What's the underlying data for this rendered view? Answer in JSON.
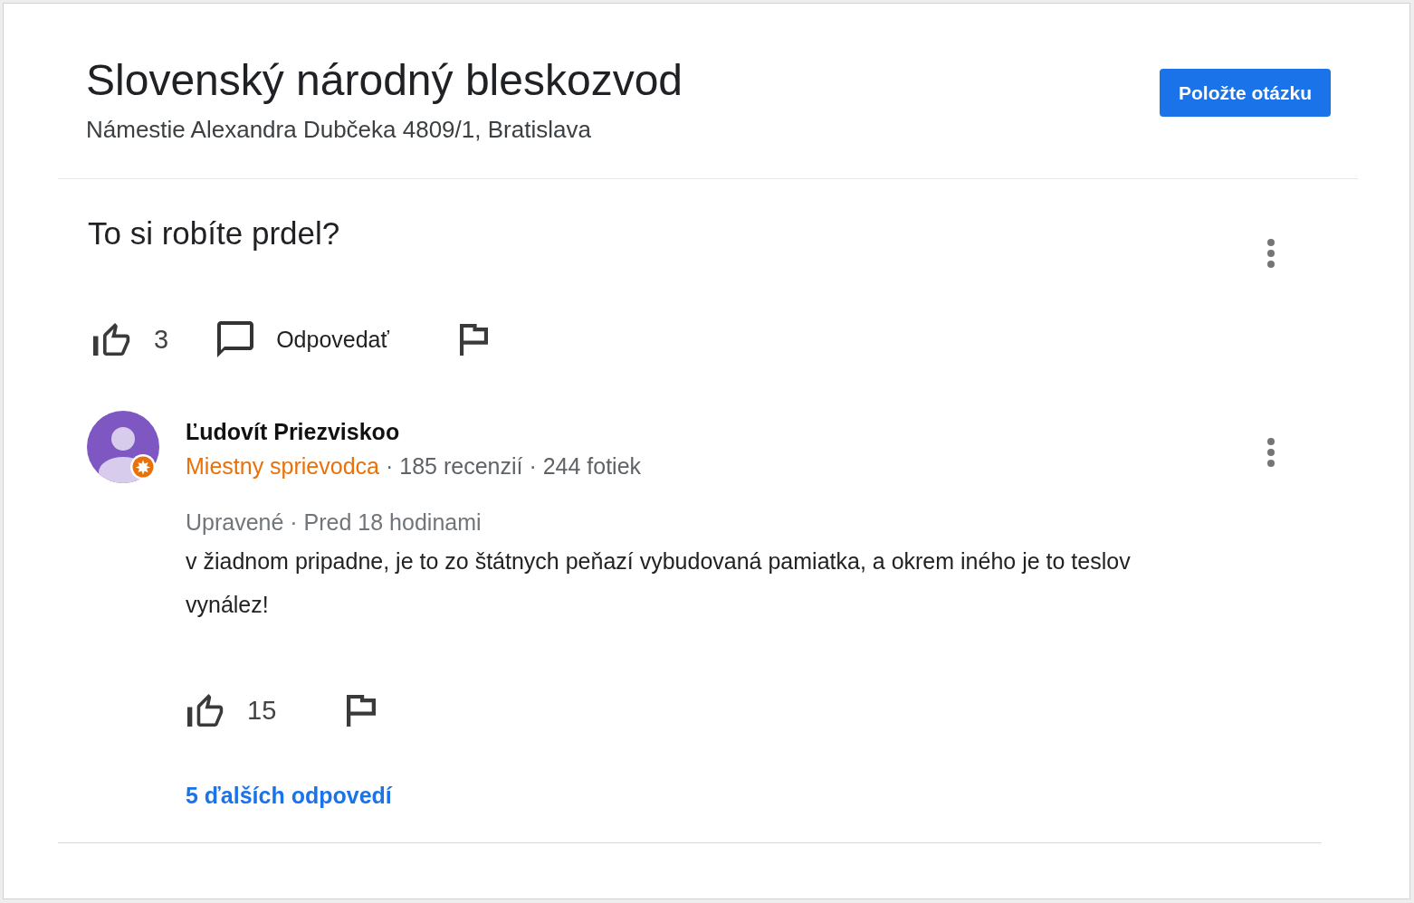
{
  "place": {
    "name": "Slovenský národný bleskozvod",
    "address": "Námestie Alexandra Dubčeka 4809/1, Bratislava"
  },
  "ask_button": {
    "label": "Položte otázku"
  },
  "question": {
    "text": "To si robíte prdel?",
    "likes": "3",
    "reply_label": "Odpovedať"
  },
  "answers": [
    {
      "author": "Ľudovít Priezviskoo",
      "local_guide_label": "Miestny sprievodca",
      "profile_stats": "· 185 recenzií · 244 fotiek",
      "timestamp": "Upravené · Pred 18 hodinami",
      "text": "v žiadnom pripadne, je to zo štátnych peňazí vybudovaná pamiatka, a okrem iného je to teslov vynález!",
      "likes": "15"
    }
  ],
  "more_replies_link": "5 ďalších odpovedí"
}
